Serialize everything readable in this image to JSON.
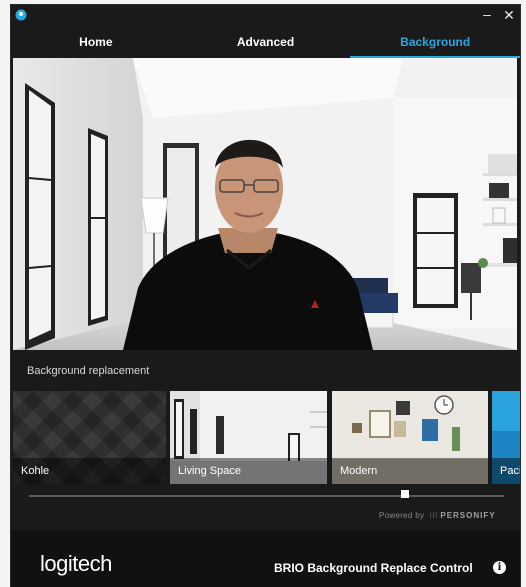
{
  "window": {
    "minimize_glyph": "–",
    "close_glyph": "✕"
  },
  "tabs": [
    {
      "label": "Home",
      "active": false
    },
    {
      "label": "Advanced",
      "active": false
    },
    {
      "label": "Background",
      "active": true
    }
  ],
  "background_section": {
    "label": "Background replacement",
    "options": [
      {
        "name": "Kohle",
        "selected": false
      },
      {
        "name": "Living Space",
        "selected": true
      },
      {
        "name": "Modern",
        "selected": false
      },
      {
        "name": "Pacif",
        "selected": false
      }
    ]
  },
  "powered_by": {
    "prefix": "Powered by",
    "brand": "PERSONIFY"
  },
  "footer": {
    "logo": "logitech",
    "product_name": "BRIO Background Replace Control",
    "info_glyph": "i"
  },
  "colors": {
    "accent": "#29a8e0",
    "window_bg": "#1a1a1a",
    "footer_bg": "#111111"
  }
}
